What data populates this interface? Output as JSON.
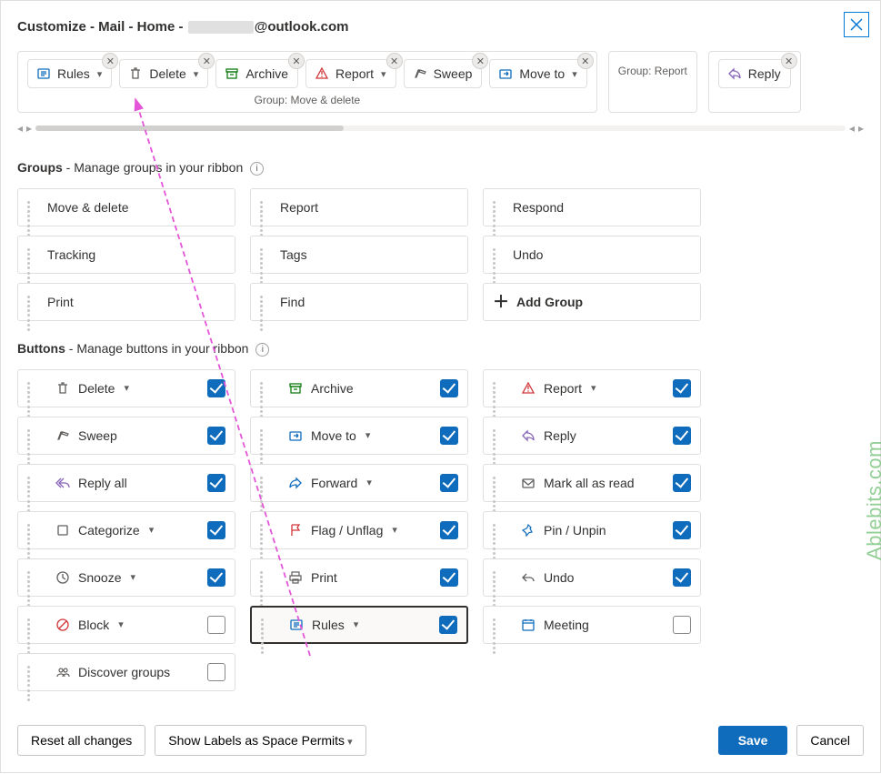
{
  "title_prefix": "Customize - Mail - Home - ",
  "title_suffix": "@outlook.com",
  "ribbon": {
    "groups": [
      {
        "caption": "Group: Move & delete",
        "buttons": [
          {
            "label": "Rules",
            "icon": "rules",
            "dropdown": true
          },
          {
            "label": "Delete",
            "icon": "delete",
            "dropdown": true
          },
          {
            "label": "Archive",
            "icon": "archive",
            "dropdown": false
          },
          {
            "label": "Report",
            "icon": "report",
            "dropdown": true
          },
          {
            "label": "Sweep",
            "icon": "sweep",
            "dropdown": false
          },
          {
            "label": "Move to",
            "icon": "moveto",
            "dropdown": true
          }
        ]
      },
      {
        "caption": "Group: Report",
        "buttons": []
      },
      {
        "caption": "",
        "buttons": [
          {
            "label": "Reply",
            "icon": "reply",
            "dropdown": false
          }
        ]
      }
    ]
  },
  "groups_section": {
    "heading_strong": "Groups",
    "heading_rest": " - Manage groups in your ribbon",
    "items": [
      "Move & delete",
      "Report",
      "Respond",
      "Tracking",
      "Tags",
      "Undo",
      "Print",
      "Find"
    ],
    "add_label": "Add Group"
  },
  "buttons_section": {
    "heading_strong": "Buttons",
    "heading_rest": " - Manage buttons in your ribbon",
    "items": [
      {
        "label": "Delete",
        "icon": "delete",
        "dropdown": true,
        "checked": true
      },
      {
        "label": "Archive",
        "icon": "archive",
        "dropdown": false,
        "checked": true
      },
      {
        "label": "Report",
        "icon": "report",
        "dropdown": true,
        "checked": true
      },
      {
        "label": "Sweep",
        "icon": "sweep",
        "dropdown": false,
        "checked": true
      },
      {
        "label": "Move to",
        "icon": "moveto",
        "dropdown": true,
        "checked": true
      },
      {
        "label": "Reply",
        "icon": "reply",
        "dropdown": false,
        "checked": true
      },
      {
        "label": "Reply all",
        "icon": "replyall",
        "dropdown": false,
        "checked": true
      },
      {
        "label": "Forward",
        "icon": "forward",
        "dropdown": true,
        "checked": true
      },
      {
        "label": "Mark all as read",
        "icon": "markread",
        "dropdown": false,
        "checked": true
      },
      {
        "label": "Categorize",
        "icon": "categorize",
        "dropdown": true,
        "checked": true
      },
      {
        "label": "Flag / Unflag",
        "icon": "flag",
        "dropdown": true,
        "checked": true
      },
      {
        "label": "Pin / Unpin",
        "icon": "pin",
        "dropdown": false,
        "checked": true
      },
      {
        "label": "Snooze",
        "icon": "snooze",
        "dropdown": true,
        "checked": true
      },
      {
        "label": "Print",
        "icon": "print",
        "dropdown": false,
        "checked": true
      },
      {
        "label": "Undo",
        "icon": "undo",
        "dropdown": false,
        "checked": true
      },
      {
        "label": "Block",
        "icon": "block",
        "dropdown": true,
        "checked": false
      },
      {
        "label": "Rules",
        "icon": "rules",
        "dropdown": true,
        "checked": true,
        "selected": true
      },
      {
        "label": "Meeting",
        "icon": "meeting",
        "dropdown": false,
        "checked": false
      },
      {
        "label": "Discover groups",
        "icon": "discover",
        "dropdown": false,
        "checked": false
      }
    ]
  },
  "footer": {
    "reset": "Reset all changes",
    "show_labels": "Show Labels as Space Permits",
    "save": "Save",
    "cancel": "Cancel"
  },
  "watermark": "Ablebits.com"
}
